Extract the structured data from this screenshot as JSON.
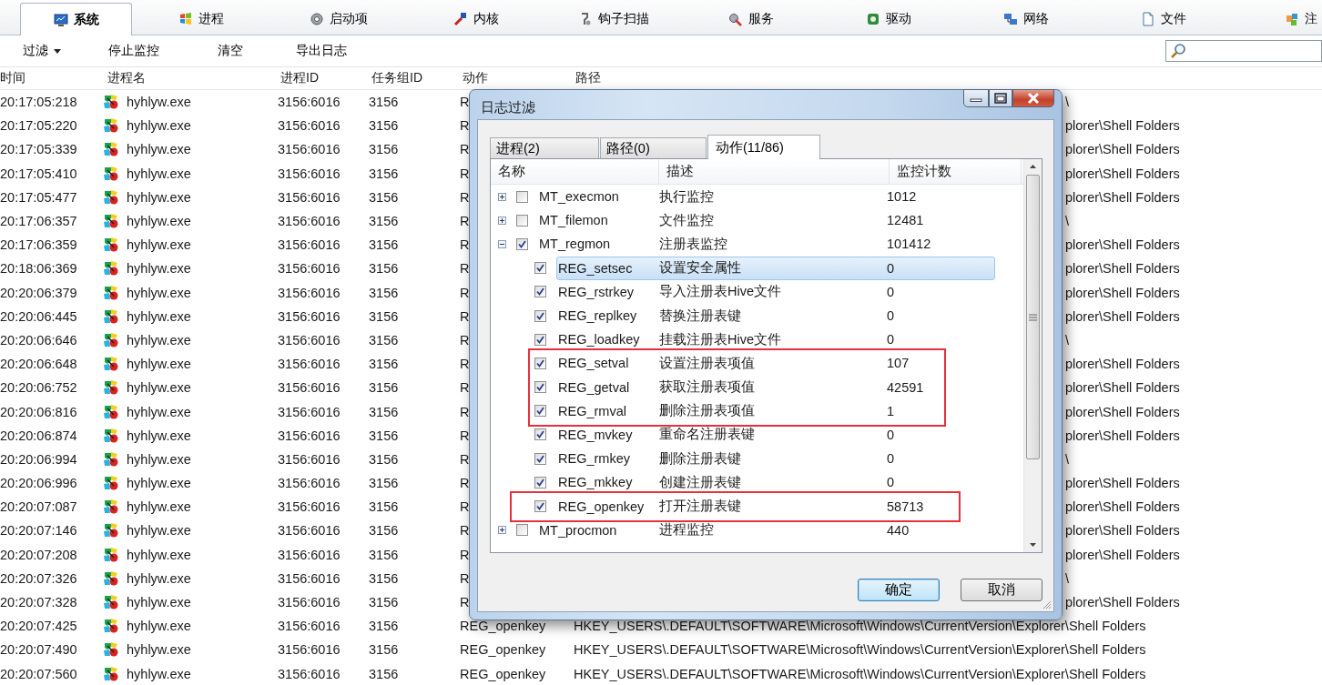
{
  "tabs": [
    {
      "label": "系统",
      "selected": true
    },
    {
      "label": "进程",
      "selected": false
    },
    {
      "label": "启动项",
      "selected": false
    },
    {
      "label": "内核",
      "selected": false
    },
    {
      "label": "钩子扫描",
      "selected": false
    },
    {
      "label": "服务",
      "selected": false
    },
    {
      "label": "驱动",
      "selected": false
    },
    {
      "label": "网络",
      "selected": false
    },
    {
      "label": "文件",
      "selected": false
    },
    {
      "label": "注",
      "selected": false
    }
  ],
  "toolbar": [
    {
      "label": "过滤",
      "kind": "dropdown"
    },
    {
      "label": "停止监控",
      "kind": "plain"
    },
    {
      "label": "清空",
      "kind": "plain"
    },
    {
      "label": "导出日志",
      "kind": "plain"
    }
  ],
  "table": {
    "columns": [
      "时间",
      "进程名",
      "进程ID",
      "任务组ID",
      "动作",
      "路径"
    ],
    "rows": [
      {
        "time": "20:17:05:218",
        "process": "hyhlyw.exe",
        "pid": "3156:6016",
        "tgid": "3156",
        "action": "R",
        "path": "\\",
        "covered": true
      },
      {
        "time": "20:17:05:220",
        "process": "hyhlyw.exe",
        "pid": "3156:6016",
        "tgid": "3156",
        "action": "R",
        "path": "plorer\\Shell Folders",
        "covered": true
      },
      {
        "time": "20:17:05:339",
        "process": "hyhlyw.exe",
        "pid": "3156:6016",
        "tgid": "3156",
        "action": "R",
        "path": "plorer\\Shell Folders",
        "covered": true
      },
      {
        "time": "20:17:05:410",
        "process": "hyhlyw.exe",
        "pid": "3156:6016",
        "tgid": "3156",
        "action": "R",
        "path": "plorer\\Shell Folders",
        "covered": true
      },
      {
        "time": "20:17:05:477",
        "process": "hyhlyw.exe",
        "pid": "3156:6016",
        "tgid": "3156",
        "action": "R",
        "path": "plorer\\Shell Folders",
        "covered": true
      },
      {
        "time": "20:17:06:357",
        "process": "hyhlyw.exe",
        "pid": "3156:6016",
        "tgid": "3156",
        "action": "R",
        "path": "\\",
        "covered": true
      },
      {
        "time": "20:17:06:359",
        "process": "hyhlyw.exe",
        "pid": "3156:6016",
        "tgid": "3156",
        "action": "R",
        "path": "plorer\\Shell Folders",
        "covered": true
      },
      {
        "time": "20:18:06:369",
        "process": "hyhlyw.exe",
        "pid": "3156:6016",
        "tgid": "3156",
        "action": "R",
        "path": "plorer\\Shell Folders",
        "covered": true
      },
      {
        "time": "20:20:06:379",
        "process": "hyhlyw.exe",
        "pid": "3156:6016",
        "tgid": "3156",
        "action": "R",
        "path": "plorer\\Shell Folders",
        "covered": true
      },
      {
        "time": "20:20:06:445",
        "process": "hyhlyw.exe",
        "pid": "3156:6016",
        "tgid": "3156",
        "action": "R",
        "path": "plorer\\Shell Folders",
        "covered": true
      },
      {
        "time": "20:20:06:646",
        "process": "hyhlyw.exe",
        "pid": "3156:6016",
        "tgid": "3156",
        "action": "R",
        "path": "\\",
        "covered": true
      },
      {
        "time": "20:20:06:648",
        "process": "hyhlyw.exe",
        "pid": "3156:6016",
        "tgid": "3156",
        "action": "R",
        "path": "plorer\\Shell Folders",
        "covered": true
      },
      {
        "time": "20:20:06:752",
        "process": "hyhlyw.exe",
        "pid": "3156:6016",
        "tgid": "3156",
        "action": "R",
        "path": "plorer\\Shell Folders",
        "covered": true
      },
      {
        "time": "20:20:06:816",
        "process": "hyhlyw.exe",
        "pid": "3156:6016",
        "tgid": "3156",
        "action": "R",
        "path": "plorer\\Shell Folders",
        "covered": true
      },
      {
        "time": "20:20:06:874",
        "process": "hyhlyw.exe",
        "pid": "3156:6016",
        "tgid": "3156",
        "action": "R",
        "path": "plorer\\Shell Folders",
        "covered": true
      },
      {
        "time": "20:20:06:994",
        "process": "hyhlyw.exe",
        "pid": "3156:6016",
        "tgid": "3156",
        "action": "R",
        "path": "\\",
        "covered": true
      },
      {
        "time": "20:20:06:996",
        "process": "hyhlyw.exe",
        "pid": "3156:6016",
        "tgid": "3156",
        "action": "R",
        "path": "plorer\\Shell Folders",
        "covered": true
      },
      {
        "time": "20:20:07:087",
        "process": "hyhlyw.exe",
        "pid": "3156:6016",
        "tgid": "3156",
        "action": "R",
        "path": "plorer\\Shell Folders",
        "covered": true
      },
      {
        "time": "20:20:07:146",
        "process": "hyhlyw.exe",
        "pid": "3156:6016",
        "tgid": "3156",
        "action": "R",
        "path": "plorer\\Shell Folders",
        "covered": true
      },
      {
        "time": "20:20:07:208",
        "process": "hyhlyw.exe",
        "pid": "3156:6016",
        "tgid": "3156",
        "action": "R",
        "path": "plorer\\Shell Folders",
        "covered": true
      },
      {
        "time": "20:20:07:326",
        "process": "hyhlyw.exe",
        "pid": "3156:6016",
        "tgid": "3156",
        "action": "R",
        "path": "\\",
        "covered": true
      },
      {
        "time": "20:20:07:328",
        "process": "hyhlyw.exe",
        "pid": "3156:6016",
        "tgid": "3156",
        "action": "R",
        "path": "plorer\\Shell Folders",
        "covered": true
      },
      {
        "time": "20:20:07:425",
        "process": "hyhlyw.exe",
        "pid": "3156:6016",
        "tgid": "3156",
        "action": "REG_openkey",
        "path": "HKEY_USERS\\.DEFAULT\\SOFTWARE\\Microsoft\\Windows\\CurrentVersion\\Explorer\\Shell Folders",
        "covered": false
      },
      {
        "time": "20:20:07:490",
        "process": "hyhlyw.exe",
        "pid": "3156:6016",
        "tgid": "3156",
        "action": "REG_openkey",
        "path": "HKEY_USERS\\.DEFAULT\\SOFTWARE\\Microsoft\\Windows\\CurrentVersion\\Explorer\\Shell Folders",
        "covered": false
      },
      {
        "time": "20:20:07:560",
        "process": "hyhlyw.exe",
        "pid": "3156:6016",
        "tgid": "3156",
        "action": "REG_openkey",
        "path": "HKEY_USERS\\.DEFAULT\\SOFTWARE\\Microsoft\\Windows\\CurrentVersion\\Explorer\\Shell Folders",
        "covered": false
      }
    ]
  },
  "dialog": {
    "title": "日志过滤",
    "tabs": [
      {
        "label": "进程(2)",
        "selected": false
      },
      {
        "label": "路径(0)",
        "selected": false
      },
      {
        "label": "动作(11/86)",
        "selected": true
      }
    ],
    "columns": [
      "名称",
      "描述",
      "监控计数"
    ],
    "items": [
      {
        "name": "MT_execmon",
        "desc": "执行监控",
        "count": "1012",
        "checked": false,
        "expanded": false
      },
      {
        "name": "MT_filemon",
        "desc": "文件监控",
        "count": "12481",
        "checked": false,
        "expanded": false
      },
      {
        "name": "MT_regmon",
        "desc": "注册表监控",
        "count": "101412",
        "checked": true,
        "expanded": true,
        "children": [
          {
            "name": "REG_setsec",
            "desc": "设置安全属性",
            "count": "0",
            "checked": true,
            "selected": true,
            "annotated": false
          },
          {
            "name": "REG_rstrkey",
            "desc": "导入注册表Hive文件",
            "count": "0",
            "checked": true,
            "selected": false,
            "annotated": false
          },
          {
            "name": "REG_replkey",
            "desc": "替换注册表键",
            "count": "0",
            "checked": true,
            "selected": false,
            "annotated": false
          },
          {
            "name": "REG_loadkey",
            "desc": "挂载注册表Hive文件",
            "count": "0",
            "checked": true,
            "selected": false,
            "annotated": false
          },
          {
            "name": "REG_setval",
            "desc": "设置注册表项值",
            "count": "107",
            "checked": true,
            "selected": false,
            "annotated": true
          },
          {
            "name": "REG_getval",
            "desc": "获取注册表项值",
            "count": "42591",
            "checked": true,
            "selected": false,
            "annotated": true
          },
          {
            "name": "REG_rmval",
            "desc": "删除注册表项值",
            "count": "1",
            "checked": true,
            "selected": false,
            "annotated": true
          },
          {
            "name": "REG_mvkey",
            "desc": "重命名注册表键",
            "count": "0",
            "checked": true,
            "selected": false,
            "annotated": false
          },
          {
            "name": "REG_rmkey",
            "desc": "删除注册表键",
            "count": "0",
            "checked": true,
            "selected": false,
            "annotated": false
          },
          {
            "name": "REG_mkkey",
            "desc": "创建注册表键",
            "count": "0",
            "checked": true,
            "selected": false,
            "annotated": false
          },
          {
            "name": "REG_openkey",
            "desc": "打开注册表键",
            "count": "58713",
            "checked": true,
            "selected": false,
            "annotated": true
          }
        ]
      },
      {
        "name": "MT_procmon",
        "desc": "进程监控",
        "count": "440",
        "checked": false,
        "expanded": false
      }
    ],
    "buttons": [
      {
        "label": "确定",
        "default": true
      },
      {
        "label": "取消",
        "default": false
      }
    ]
  }
}
